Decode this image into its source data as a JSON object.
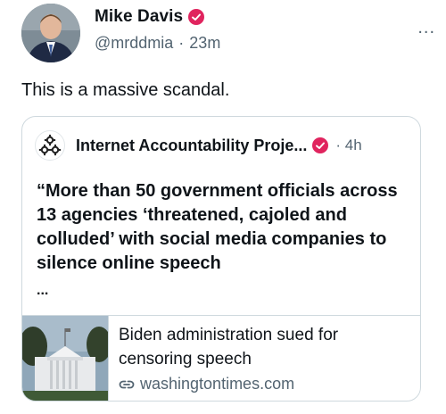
{
  "tweet": {
    "author_name": "Mike Davis",
    "handle": "@mrddmia",
    "separator": "·",
    "time": "23m",
    "more_label": "...",
    "text": "This is a massive scandal."
  },
  "quoted": {
    "author_name": "Internet Accountability Proje...",
    "separator": "·",
    "time": "4h",
    "text": "“More than 50 government officials across 13 agencies ‘threatened, cajoled and colluded’ with social media companies to silence online speech",
    "ellipsis": "...",
    "card": {
      "title": "Biden administration sued for censoring speech",
      "domain": "washingtontimes.com"
    }
  },
  "icons": {
    "verified": "verified-badge-icon",
    "link": "link-icon",
    "more": "more-icon"
  },
  "colors": {
    "verified": "#e0245e",
    "secondary_text": "#536471",
    "border": "#cfd9de"
  }
}
